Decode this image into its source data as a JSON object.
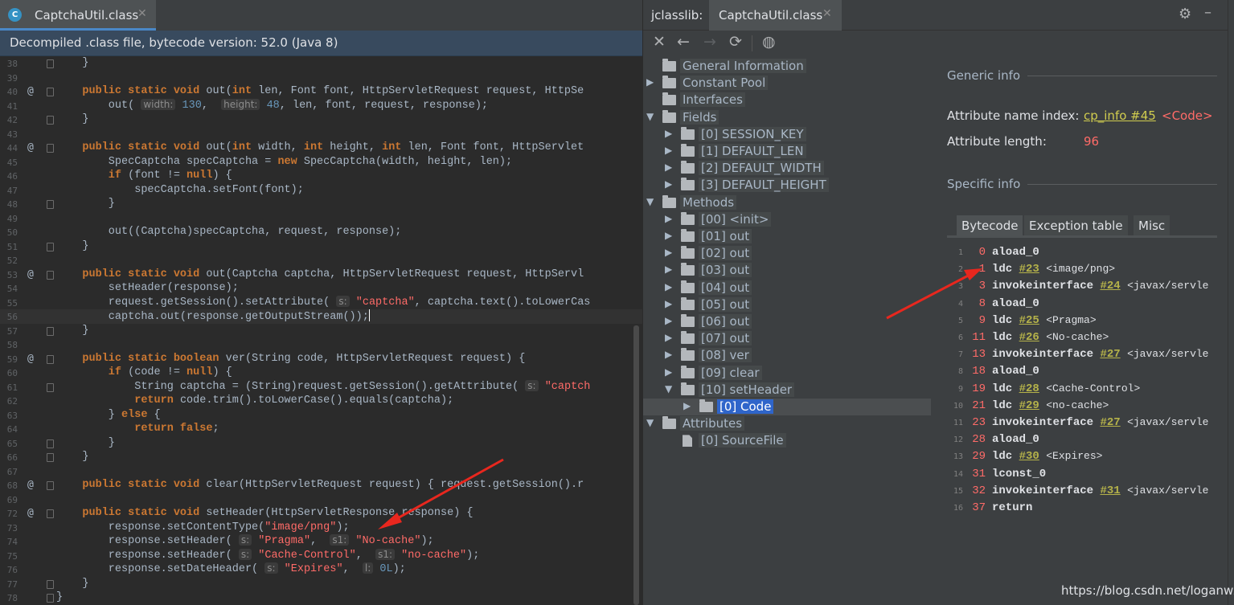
{
  "editor": {
    "tab_icon": "C",
    "tab_title": "CaptchaUtil.class",
    "tab_close": "✕",
    "banner": "Decompiled .class file, bytecode version: 52.0 (Java 8)"
  },
  "jclasslib": {
    "label": "jclasslib:",
    "tab_title": "CaptchaUtil.class",
    "tab_close": "✕",
    "tree": [
      {
        "label": "General Information"
      },
      {
        "label": "Constant Pool"
      },
      {
        "label": "Interfaces"
      },
      {
        "label": "Fields"
      },
      {
        "label": "[0] SESSION_KEY"
      },
      {
        "label": "[1] DEFAULT_LEN"
      },
      {
        "label": "[2] DEFAULT_WIDTH"
      },
      {
        "label": "[3] DEFAULT_HEIGHT"
      },
      {
        "label": "Methods"
      },
      {
        "label": "[00] <init>"
      },
      {
        "label": "[01] out"
      },
      {
        "label": "[02] out"
      },
      {
        "label": "[03] out"
      },
      {
        "label": "[04] out"
      },
      {
        "label": "[05] out"
      },
      {
        "label": "[06] out"
      },
      {
        "label": "[07] out"
      },
      {
        "label": "[08] ver"
      },
      {
        "label": "[09] clear"
      },
      {
        "label": "[10] setHeader"
      },
      {
        "label": "[0] Code"
      },
      {
        "label": "Attributes"
      },
      {
        "label": "[0] SourceFile"
      }
    ],
    "detail": {
      "generic_title": "Generic info",
      "attr_name_label": "Attribute name index:",
      "attr_name_link": "cp_info #45",
      "attr_name_value": "<Code>",
      "attr_length_label": "Attribute length:",
      "attr_length_value": "96",
      "specific_title": "Specific info",
      "tabs": [
        "Bytecode",
        "Exception table",
        "Misc"
      ]
    },
    "bytecode": [
      {
        "idx": "1",
        "off": "0",
        "op": "aload_0",
        "ref": "",
        "cmt": ""
      },
      {
        "idx": "2",
        "off": "1",
        "op": "ldc",
        "ref": "#23",
        "cmt": "<image/png>"
      },
      {
        "idx": "3",
        "off": "3",
        "op": "invokeinterface",
        "ref": "#24",
        "cmt": "<javax/servle"
      },
      {
        "idx": "4",
        "off": "8",
        "op": "aload_0",
        "ref": "",
        "cmt": ""
      },
      {
        "idx": "5",
        "off": "9",
        "op": "ldc",
        "ref": "#25",
        "cmt": "<Pragma>"
      },
      {
        "idx": "6",
        "off": "11",
        "op": "ldc",
        "ref": "#26",
        "cmt": "<No-cache>"
      },
      {
        "idx": "7",
        "off": "13",
        "op": "invokeinterface",
        "ref": "#27",
        "cmt": "<javax/servle"
      },
      {
        "idx": "8",
        "off": "18",
        "op": "aload_0",
        "ref": "",
        "cmt": ""
      },
      {
        "idx": "9",
        "off": "19",
        "op": "ldc",
        "ref": "#28",
        "cmt": "<Cache-Control>"
      },
      {
        "idx": "10",
        "off": "21",
        "op": "ldc",
        "ref": "#29",
        "cmt": "<no-cache>"
      },
      {
        "idx": "11",
        "off": "23",
        "op": "invokeinterface",
        "ref": "#27",
        "cmt": "<javax/servle"
      },
      {
        "idx": "12",
        "off": "28",
        "op": "aload_0",
        "ref": "",
        "cmt": ""
      },
      {
        "idx": "13",
        "off": "29",
        "op": "ldc",
        "ref": "#30",
        "cmt": "<Expires>"
      },
      {
        "idx": "14",
        "off": "31",
        "op": "lconst_0",
        "ref": "",
        "cmt": ""
      },
      {
        "idx": "15",
        "off": "32",
        "op": "invokeinterface",
        "ref": "#31",
        "cmt": "<javax/servle"
      },
      {
        "idx": "16",
        "off": "37",
        "op": "return",
        "ref": "",
        "cmt": ""
      }
    ]
  },
  "code_lines": [
    {
      "n": "38",
      "t": [
        [
          "p",
          "    }"
        ]
      ]
    },
    {
      "n": "39",
      "t": []
    },
    {
      "n": "40",
      "t": [
        [
          "k",
          "    public static void "
        ],
        [
          "p",
          "out("
        ],
        [
          "k",
          "int "
        ],
        [
          "p",
          "len, Font font, HttpServletRequest request, HttpSe"
        ]
      ]
    },
    {
      "n": "41",
      "t": [
        [
          "p",
          "        out( "
        ],
        [
          "h",
          "width:"
        ],
        [
          "n",
          " 130"
        ],
        [
          "p",
          ",  "
        ],
        [
          "h",
          "height:"
        ],
        [
          "n",
          " 48"
        ],
        [
          "p",
          ", len, font, request, response);"
        ]
      ]
    },
    {
      "n": "42",
      "t": [
        [
          "p",
          "    }"
        ]
      ]
    },
    {
      "n": "43",
      "t": []
    },
    {
      "n": "44",
      "t": [
        [
          "k",
          "    public static void "
        ],
        [
          "p",
          "out("
        ],
        [
          "k",
          "int "
        ],
        [
          "p",
          "width, "
        ],
        [
          "k",
          "int "
        ],
        [
          "p",
          "height, "
        ],
        [
          "k",
          "int "
        ],
        [
          "p",
          "len, Font font, HttpServlet"
        ]
      ]
    },
    {
      "n": "45",
      "t": [
        [
          "p",
          "        SpecCaptcha specCaptcha = "
        ],
        [
          "k",
          "new "
        ],
        [
          "p",
          "SpecCaptcha(width, height, len);"
        ]
      ]
    },
    {
      "n": "46",
      "t": [
        [
          "k",
          "        if "
        ],
        [
          "p",
          "(font != "
        ],
        [
          "k",
          "null"
        ],
        [
          "p",
          ") {"
        ]
      ]
    },
    {
      "n": "47",
      "t": [
        [
          "p",
          "            specCaptcha.setFont(font);"
        ]
      ]
    },
    {
      "n": "48",
      "t": [
        [
          "p",
          "        }"
        ]
      ]
    },
    {
      "n": "49",
      "t": []
    },
    {
      "n": "50",
      "t": [
        [
          "p",
          "        out((Captcha)specCaptcha, request, response);"
        ]
      ]
    },
    {
      "n": "51",
      "t": [
        [
          "p",
          "    }"
        ]
      ]
    },
    {
      "n": "52",
      "t": []
    },
    {
      "n": "53",
      "t": [
        [
          "k",
          "    public static void "
        ],
        [
          "p",
          "out(Captcha captcha, HttpServletRequest request, HttpServl"
        ]
      ]
    },
    {
      "n": "54",
      "t": [
        [
          "p",
          "        setHeader(response);"
        ]
      ]
    },
    {
      "n": "55",
      "t": [
        [
          "p",
          "        request.getSession().setAttribute( "
        ],
        [
          "h",
          "s:"
        ],
        [
          "s2",
          " \"captcha\""
        ],
        [
          "p",
          ", captcha.text().toLowerCas"
        ]
      ]
    },
    {
      "n": "56",
      "t": [
        [
          "p",
          "        captcha.out(response.getOutputStream());"
        ],
        [
          "c",
          ""
        ]
      ]
    },
    {
      "n": "57",
      "t": [
        [
          "p",
          "    }"
        ]
      ]
    },
    {
      "n": "58",
      "t": []
    },
    {
      "n": "59",
      "t": [
        [
          "k",
          "    public static boolean "
        ],
        [
          "p",
          "ver(String code, HttpServletRequest request) {"
        ]
      ]
    },
    {
      "n": "60",
      "t": [
        [
          "k",
          "        if "
        ],
        [
          "p",
          "(code != "
        ],
        [
          "k",
          "null"
        ],
        [
          "p",
          ") {"
        ]
      ]
    },
    {
      "n": "61",
      "t": [
        [
          "p",
          "            String captcha = (String)request.getSession().getAttribute( "
        ],
        [
          "h",
          "s:"
        ],
        [
          "s2",
          " \"captch"
        ]
      ]
    },
    {
      "n": "62",
      "t": [
        [
          "k",
          "            return "
        ],
        [
          "p",
          "code.trim().toLowerCase().equals(captcha);"
        ]
      ]
    },
    {
      "n": "63",
      "t": [
        [
          "p",
          "        } "
        ],
        [
          "k",
          "else "
        ],
        [
          "p",
          "{"
        ]
      ]
    },
    {
      "n": "64",
      "t": [
        [
          "k",
          "            return false"
        ],
        [
          "p",
          ";"
        ]
      ]
    },
    {
      "n": "65",
      "t": [
        [
          "p",
          "        }"
        ]
      ]
    },
    {
      "n": "66",
      "t": [
        [
          "p",
          "    }"
        ]
      ]
    },
    {
      "n": "67",
      "t": []
    },
    {
      "n": "68",
      "t": [
        [
          "k",
          "    public static void "
        ],
        [
          "p",
          "clear(HttpServletRequest request) { request.getSession().r"
        ]
      ]
    },
    {
      "n": "69",
      "t": []
    },
    {
      "n": "72",
      "t": [
        [
          "k",
          "    public static void "
        ],
        [
          "p",
          "setHeader(HttpServletResponse response) {"
        ]
      ]
    },
    {
      "n": "73",
      "t": [
        [
          "p",
          "        response.setContentType("
        ],
        [
          "s2",
          "\"image/png\""
        ],
        [
          "p",
          ");"
        ]
      ]
    },
    {
      "n": "74",
      "t": [
        [
          "p",
          "        response.setHeader( "
        ],
        [
          "h",
          "s:"
        ],
        [
          "s2",
          " \"Pragma\""
        ],
        [
          "p",
          ",  "
        ],
        [
          "h",
          "s1:"
        ],
        [
          "s2",
          " \"No-cache\""
        ],
        [
          "p",
          ");"
        ]
      ]
    },
    {
      "n": "75",
      "t": [
        [
          "p",
          "        response.setHeader( "
        ],
        [
          "h",
          "s:"
        ],
        [
          "s2",
          " \"Cache-Control\""
        ],
        [
          "p",
          ",  "
        ],
        [
          "h",
          "s1:"
        ],
        [
          "s2",
          " \"no-cache\""
        ],
        [
          "p",
          ");"
        ]
      ]
    },
    {
      "n": "76",
      "t": [
        [
          "p",
          "        response.setDateHeader( "
        ],
        [
          "h",
          "s:"
        ],
        [
          "s2",
          " \"Expires\""
        ],
        [
          "p",
          ",  "
        ],
        [
          "h",
          "l:"
        ],
        [
          "n",
          " 0L"
        ],
        [
          "p",
          ");"
        ]
      ]
    },
    {
      "n": "77",
      "t": [
        [
          "p",
          "    }"
        ]
      ]
    },
    {
      "n": "78",
      "t": [
        [
          "p",
          "}"
        ]
      ]
    },
    {
      "n": "79",
      "t": []
    }
  ],
  "gutter_marker": "@",
  "watermark": "https://blog.csdn.net/loganwz",
  "colors": {
    "keyword": "#cc7832",
    "string": "#ff6b68",
    "number": "#6897bb",
    "link": "#d1cd4f",
    "selection": "#2f65ca",
    "arrow": "#e8271e"
  }
}
